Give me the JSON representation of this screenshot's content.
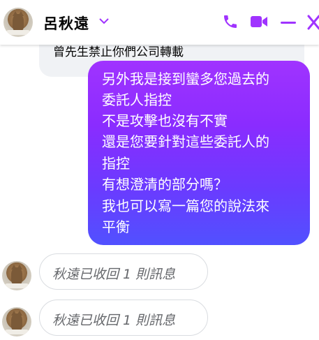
{
  "header": {
    "contact_name": "呂秋遠",
    "accent_color": "#a033ff",
    "icons": [
      "chevron-down-icon",
      "phone-icon",
      "video-icon",
      "minimize-icon",
      "close-icon"
    ]
  },
  "messages": {
    "previous_partial_text": "曾先生禁止你們公司轉載",
    "sent_lines": [
      "另外我是接到蠻多您過去的",
      "委託人指控",
      "不是攻擊也沒有不實",
      "還是您要針對這些委託人的",
      "指控",
      "有想澄清的部分嗎？",
      "我也可以寫一篇您的說法來",
      "平衡"
    ],
    "unsent": [
      {
        "text": "秋遠已收回 1 則訊息"
      },
      {
        "text": "秋遠已收回 1 則訊息"
      }
    ]
  }
}
